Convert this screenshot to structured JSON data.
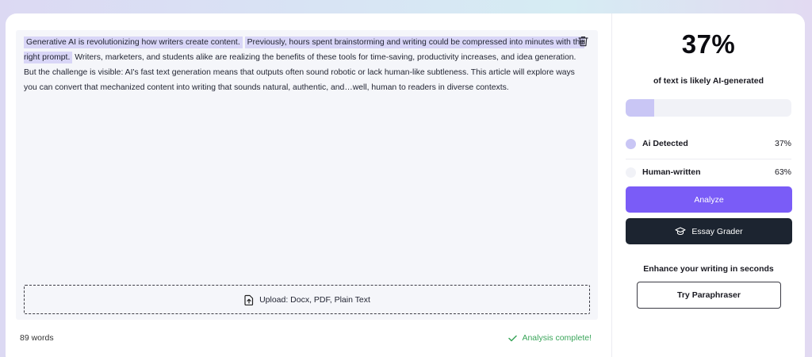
{
  "editor": {
    "sentences": [
      "Generative AI is revolutionizing how writers create content.",
      "Previously, hours spent brainstorming and writing could be compressed into minutes with the right prompt.",
      "Writers, marketers, and students alike are realizing the benefits of these tools for time-saving, productivity increases, and idea generation.",
      "But the challenge is visible: AI's fast text generation means that outputs often sound robotic or lack human-like subtleness. This article will explore ways you can convert that mechanized content into writing that sounds natural, authentic, and…well, human to readers in diverse contexts."
    ],
    "upload_label": "Upload: Docx, PDF, Plain Text"
  },
  "footer": {
    "word_count": "89 words",
    "status": "Analysis complete!"
  },
  "results": {
    "percent": "37%",
    "caption": "of text is likely AI-generated",
    "ai_fraction": 0.17,
    "ai_label": "Ai Detected",
    "ai_value": "37%",
    "human_label": "Human-written",
    "human_value": "63%"
  },
  "actions": {
    "analyze": "Analyze",
    "essay_grader": "Essay Grader",
    "enhance_title": "Enhance your writing in seconds",
    "paraphraser": "Try Paraphraser"
  },
  "colors": {
    "accent": "#7a5cf7",
    "ai_dot": "#c9c6f5",
    "human_dot": "#f1f2f7",
    "success": "#3aa55a",
    "dark_button": "#1c2430"
  }
}
